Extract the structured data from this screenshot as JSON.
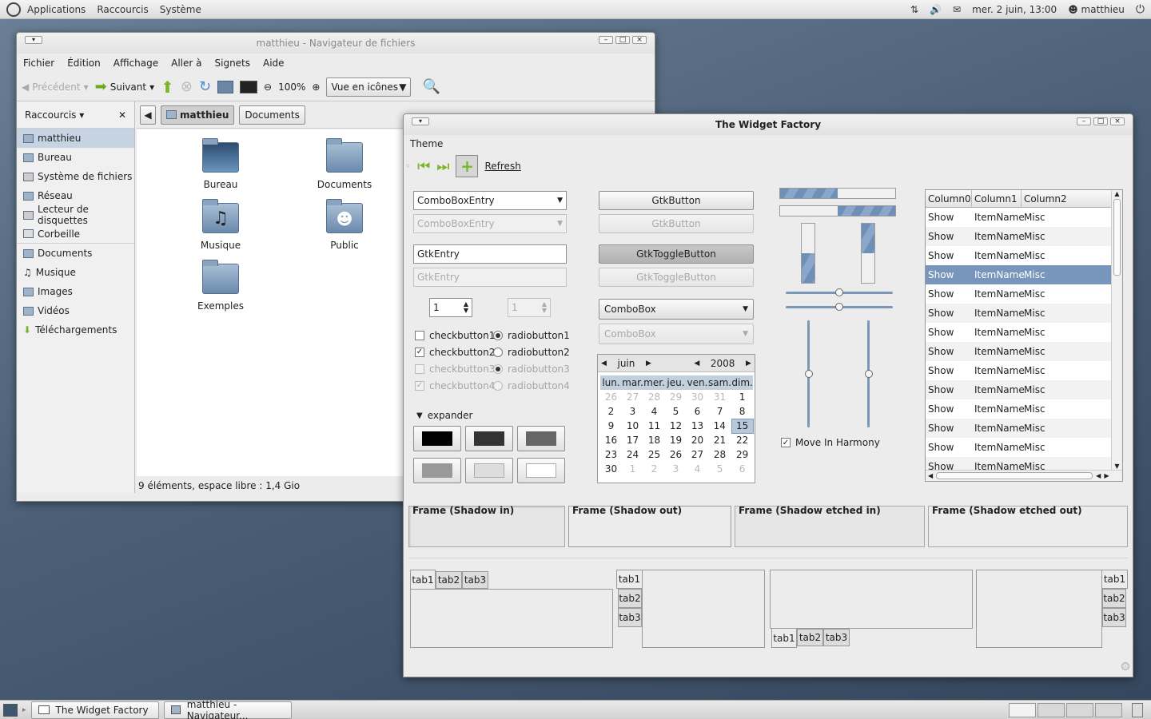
{
  "top_panel": {
    "menus": [
      "Applications",
      "Raccourcis",
      "Système"
    ],
    "clock": "mer.  2 juin, 13:00",
    "user": "matthieu"
  },
  "file_manager": {
    "title": "matthieu - Navigateur de fichiers",
    "menus": [
      "Fichier",
      "Édition",
      "Affichage",
      "Aller à",
      "Signets",
      "Aide"
    ],
    "toolbar": {
      "back": "Précédent",
      "forward": "Suivant",
      "zoom": "100%",
      "view": "Vue en icônes"
    },
    "sidebar_header": "Raccourcis ▾",
    "sidebar_items": [
      "matthieu",
      "Bureau",
      "Système de fichiers",
      "Réseau",
      "Lecteur de disquettes",
      "Corbeille",
      "Documents",
      "Musique",
      "Images",
      "Vidéos",
      "Téléchargements"
    ],
    "path": [
      "matthieu",
      "Documents"
    ],
    "icons": [
      "Bureau",
      "Documents",
      "Musique",
      "Public",
      "Exemples"
    ],
    "status": "9 éléments, espace libre : 1,4 Gio"
  },
  "widget_factory": {
    "title": "The Widget Factory",
    "menu": "Theme",
    "refresh": "Refresh",
    "combo_entry": "ComboBoxEntry",
    "entry": "GtkEntry",
    "spin": "1",
    "checkbuttons": [
      "checkbutton1",
      "checkbutton2",
      "checkbutton3",
      "checkbutton4"
    ],
    "radiobuttons": [
      "radiobutton1",
      "radiobutton2",
      "radiobutton3",
      "radiobutton4"
    ],
    "expander": "expander",
    "button": "GtkButton",
    "toggle": "GtkToggleButton",
    "combo": "ComboBox",
    "calendar": {
      "month": "juin",
      "year": "2008",
      "days": [
        "lun.",
        "mar.",
        "mer.",
        "jeu.",
        "ven.",
        "sam.",
        "dim."
      ],
      "weeks": [
        [
          "26",
          "27",
          "28",
          "29",
          "30",
          "31",
          "1"
        ],
        [
          "2",
          "3",
          "4",
          "5",
          "6",
          "7",
          "8"
        ],
        [
          "9",
          "10",
          "11",
          "12",
          "13",
          "14",
          "15"
        ],
        [
          "16",
          "17",
          "18",
          "19",
          "20",
          "21",
          "22"
        ],
        [
          "23",
          "24",
          "25",
          "26",
          "27",
          "28",
          "29"
        ],
        [
          "30",
          "1",
          "2",
          "3",
          "4",
          "5",
          "6"
        ]
      ]
    },
    "progress": [
      0.45,
      0.55
    ],
    "harmony": "Move In Harmony",
    "tree": {
      "columns": [
        "Column0",
        "Column1",
        "Column2"
      ],
      "row": [
        "Show",
        "ItemName",
        "Misc"
      ],
      "row_count": 14
    },
    "frames": [
      "Frame (Shadow in)",
      "Frame (Shadow out)",
      "Frame (Shadow etched in)",
      "Frame (Shadow etched out)"
    ],
    "tabs": [
      "tab1",
      "tab2",
      "tab3"
    ]
  },
  "taskbar": {
    "tasks": [
      "The Widget Factory",
      "matthieu - Navigateur..."
    ]
  }
}
